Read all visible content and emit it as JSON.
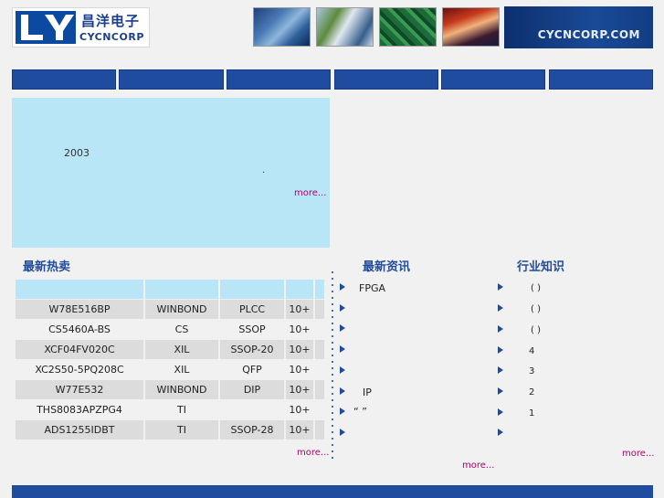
{
  "header": {
    "logo_cn": "昌洋电子",
    "logo_en": "CYCNCORP",
    "site_url": "CYCNCORP.COM"
  },
  "nav": [
    "",
    "",
    "",
    "",
    "",
    ""
  ],
  "intro": {
    "year": "2003",
    "dot": ".",
    "more": "more..."
  },
  "sections": {
    "hot": "最新热卖",
    "news": "最新资讯",
    "knowledge": "行业知识"
  },
  "hot_table": {
    "rows": [
      [
        "W78E516BP",
        "WINBOND",
        "PLCC",
        "10+"
      ],
      [
        "CS5460A-BS",
        "CS",
        "SSOP",
        "10+"
      ],
      [
        "XCF04FV020C",
        "XIL",
        "SSOP-20",
        "10+"
      ],
      [
        "XC2S50-5PQ208C",
        "XIL",
        "QFP",
        "10+"
      ],
      [
        "W77E532",
        "WINBOND",
        "DIP",
        "10+"
      ],
      [
        "THS8083APZPG4",
        "TI",
        "",
        "10+"
      ],
      [
        "ADS1255IDBT",
        "TI",
        "SSOP-28",
        "10+"
      ]
    ],
    "more": "more..."
  },
  "news": {
    "items": [
      "FPGA",
      "",
      "",
      "",
      "",
      "IP",
      "“ ”",
      ""
    ],
    "more": "more..."
  },
  "knowledge": {
    "items": [
      "( )",
      "( )",
      "( )",
      "4",
      "3",
      "2",
      "1"
    ],
    "more": "more..."
  }
}
